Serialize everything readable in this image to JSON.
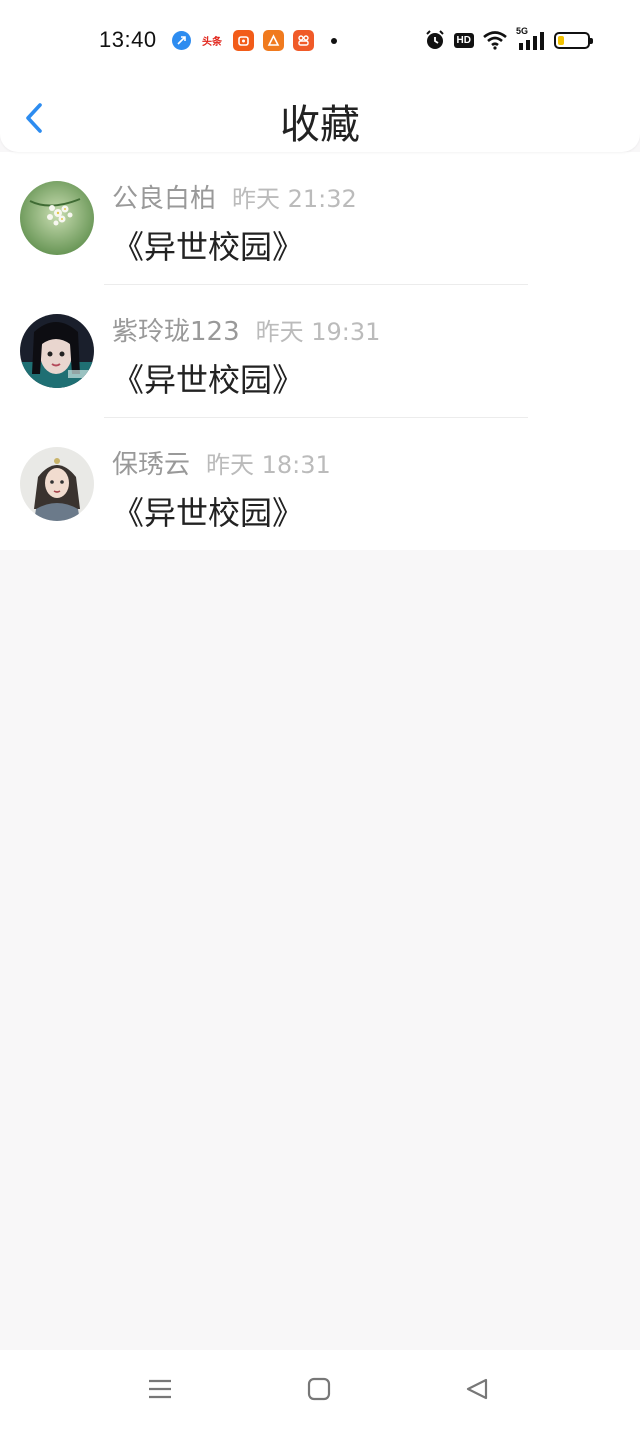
{
  "status_bar": {
    "time": "13:40",
    "notification_icons": [
      "browser-icon",
      "toutiao-icon",
      "app-icon",
      "app-icon",
      "app-icon"
    ],
    "toutiao_text": "头条",
    "network": "5G",
    "hd_label": "HD",
    "battery_level": 0.2,
    "battery_color": "#f2c200"
  },
  "header": {
    "title": "收藏",
    "back_icon": "chevron-left-icon",
    "accent_color": "#2d8cf0"
  },
  "items": [
    {
      "user": "公良白柏",
      "time": "昨天 21:32",
      "book": "《异世校园》"
    },
    {
      "user": "紫玲珑123",
      "time": "昨天 19:31",
      "book": "《异世校园》"
    },
    {
      "user": "保琇云",
      "time": "昨天 18:31",
      "book": "《异世校园》"
    }
  ],
  "navbar": {
    "icons": [
      "menu-icon",
      "home-icon",
      "back-triangle-icon"
    ]
  }
}
